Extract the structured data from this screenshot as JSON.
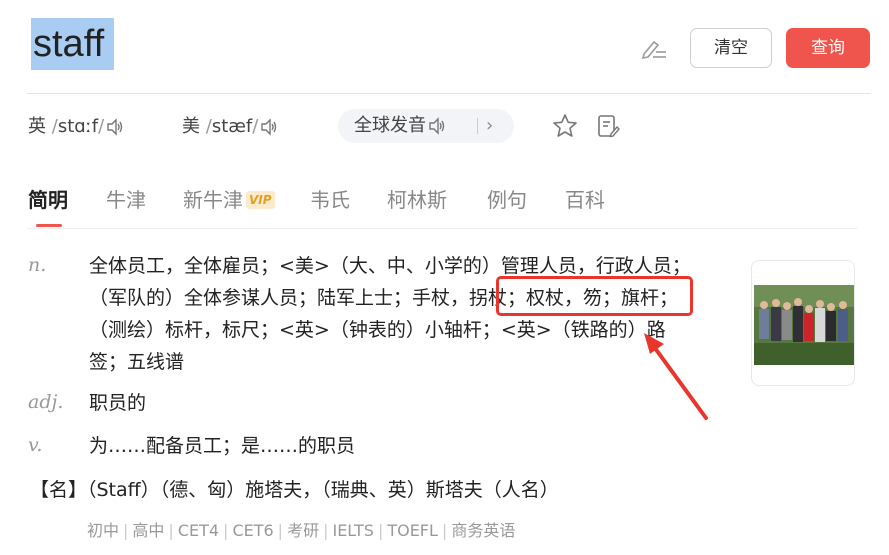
{
  "search": {
    "query": "staff",
    "clear_label": "清空",
    "submit_label": "查询"
  },
  "pronunciation": {
    "uk": {
      "label": "英",
      "phonetic": "stɑːf"
    },
    "us": {
      "label": "美",
      "phonetic": "stæf"
    },
    "global_label": "全球发音",
    "chevron": "›"
  },
  "tabs": [
    {
      "label": "简明"
    },
    {
      "label": "牛津"
    },
    {
      "label": "新牛津",
      "badge": "VIP"
    },
    {
      "label": "韦氏"
    },
    {
      "label": "柯林斯"
    },
    {
      "label": "例句"
    },
    {
      "label": "百科"
    }
  ],
  "definitions": [
    {
      "pos": "n.",
      "text": "全体员工，全体雇员；<美>（大、中、小学的）管理人员，行政人员；（军队的）全体参谋人员；陆军上士；手杖，拐杖；权杖，笏；旗杆；（测绘）标杆，标尺；<英>（钟表的）小轴杆；<英>（铁路的）路签；五线谱"
    },
    {
      "pos": "adj.",
      "text": "职员的"
    },
    {
      "pos": "v.",
      "text": "为……配备员工；是……的职员"
    }
  ],
  "name_entry": "【名】（Staff）（德、匈）施塔夫，（瑞典、英）斯塔夫（人名）",
  "levels": [
    "初中",
    "高中",
    "CET4",
    "CET6",
    "考研",
    "IELTS",
    "TOEFL",
    "商务英语"
  ],
  "colors": {
    "accent": "#f0554d",
    "highlight": "#e8362d",
    "selection": "#a9cdf2"
  }
}
